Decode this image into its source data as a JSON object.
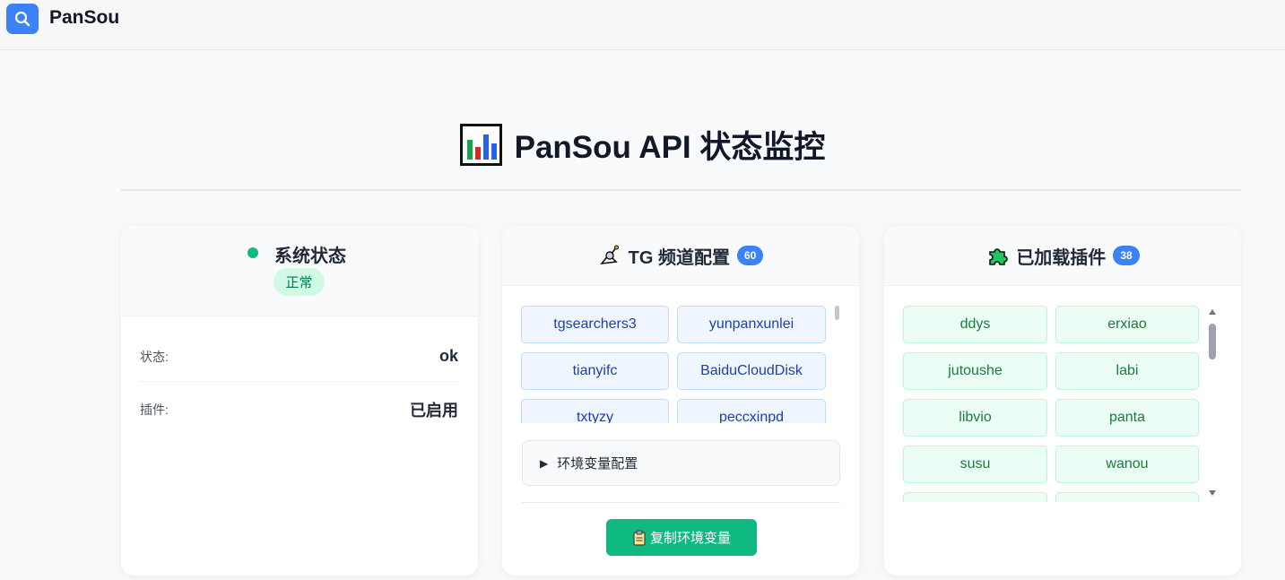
{
  "app": {
    "name": "PanSou",
    "logo_icon": "search-icon"
  },
  "page": {
    "title": "PanSou API 状态监控",
    "title_icon": "bar-chart-icon"
  },
  "system_card": {
    "title": "系统状态",
    "badge": "正常",
    "rows": [
      {
        "label": "状态:",
        "value": "ok"
      },
      {
        "label": "插件:",
        "value": "已启用"
      }
    ]
  },
  "tg_card": {
    "title": "TG 频道配置",
    "count": "60",
    "channels": [
      "tgsearchers3",
      "yunpanxunlei",
      "tianyifc",
      "BaiduCloudDisk",
      "txtyzy",
      "peccxinpd"
    ],
    "env_label": "环境变量配置",
    "copy_button": "复制环境变量"
  },
  "plugin_card": {
    "title": "已加载插件",
    "count": "38",
    "plugins": [
      "ddys",
      "erxiao",
      "jutoushe",
      "labi",
      "libvio",
      "panta",
      "susu",
      "wanou",
      "",
      ""
    ]
  },
  "colors": {
    "accent": "#3b82f6",
    "success": "#10b981"
  }
}
